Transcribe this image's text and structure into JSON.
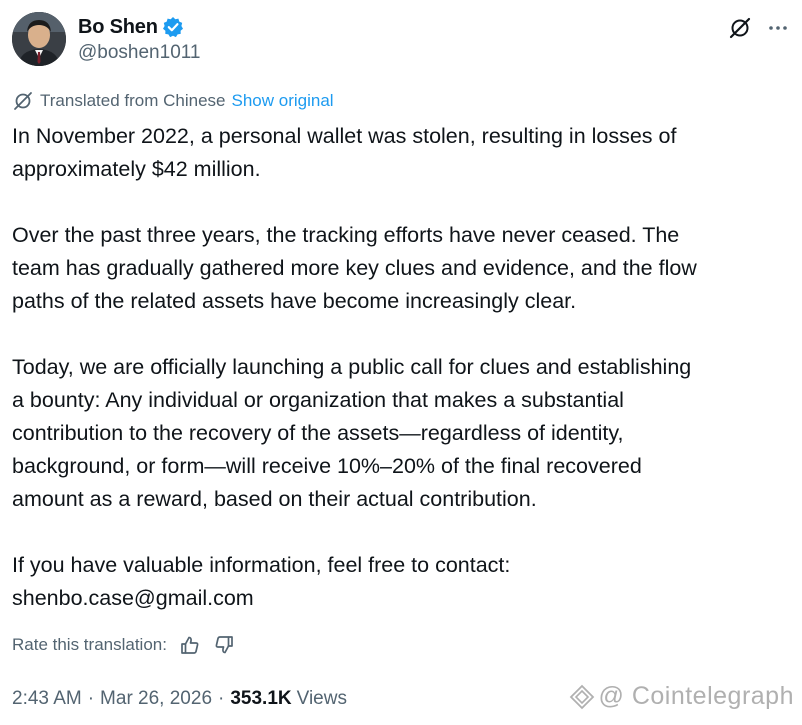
{
  "author": {
    "display_name": "Bo Shen",
    "handle": "@boshen1011",
    "verified": true
  },
  "translation": {
    "notice": "Translated from Chinese",
    "show_original": "Show original",
    "rate_label": "Rate this translation:"
  },
  "tweet": {
    "paragraphs": [
      "In November 2022, a personal wallet was stolen, resulting in losses of\napproximately $42 million.",
      "Over the past three years, the tracking efforts have never ceased. The\nteam has gradually gathered more key clues and evidence, and the flow\npaths of the related assets have become increasingly clear.",
      "Today, we are officially launching a public call for clues and establishing\na bounty: Any individual or organization that makes a substantial\ncontribution to the recovery of the assets—regardless of identity,\nbackground, or form—will receive 10%–20% of the final recovered\namount as a reward, based on their actual contribution.",
      "If you have valuable information, feel free to contact:\nshenbo.case@gmail.com"
    ]
  },
  "meta": {
    "time": "2:43 AM",
    "separator": "·",
    "date": "Mar 26, 2026",
    "views_count": "353.1K",
    "views_label": "Views"
  },
  "watermark": "@ Cointelegraph",
  "colors": {
    "text": "#0f1419",
    "secondary": "#536471",
    "link": "#1d9bf0",
    "verified_badge": "#1d9bf0"
  },
  "icons": [
    "verified-badge-icon",
    "grok-icon",
    "more-icon",
    "translate-icon",
    "thumbs-up-icon",
    "thumbs-down-icon",
    "cointelegraph-logo-icon"
  ]
}
